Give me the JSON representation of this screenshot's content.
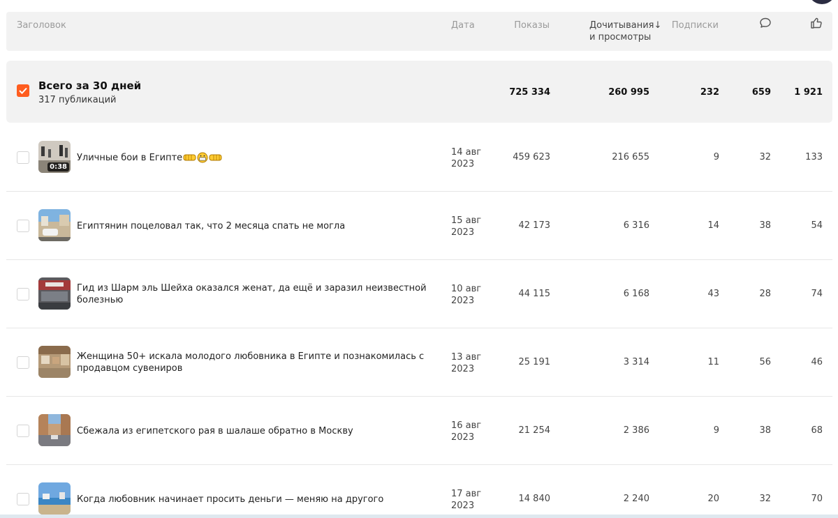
{
  "header": {
    "title": "Заголовок",
    "date": "Дата",
    "views": "Показы",
    "reads_line1": "Дочитывания",
    "reads_arrow": "↓",
    "reads_line2": "и просмотры",
    "subs": "Подписки",
    "comments_icon": "comment-icon",
    "likes_icon": "thumbs-up-icon"
  },
  "total": {
    "title": "Всего за 30 дней",
    "subtitle": "317 публикаций",
    "views": "725 334",
    "reads": "260 995",
    "subs": "232",
    "comments": "659",
    "likes": "1 921",
    "checkbox_color": "#ff5d1f"
  },
  "rows": [
    {
      "title": "Уличные бои в Египте",
      "duration": "0:38",
      "date_day": "14 авг",
      "date_year": "2023",
      "views": "459 623",
      "reads": "216 655",
      "subs": "9",
      "comments": "32",
      "likes": "133"
    },
    {
      "title": "Египтянин поцеловал так, что 2 месяца спать не могла",
      "date_day": "15 авг",
      "date_year": "2023",
      "views": "42 173",
      "reads": "6 316",
      "subs": "14",
      "comments": "38",
      "likes": "54"
    },
    {
      "title": "Гид из Шарм эль Шейха оказался женат, да ещё и заразил неизвестной болезнью",
      "date_day": "10 авг",
      "date_year": "2023",
      "views": "44 115",
      "reads": "6 168",
      "subs": "43",
      "comments": "28",
      "likes": "74"
    },
    {
      "title": "Женщина 50+ искала молодого любовника в Египте и познакомилась с продавцом сувениров",
      "date_day": "13 авг",
      "date_year": "2023",
      "views": "25 191",
      "reads": "3 314",
      "subs": "11",
      "comments": "56",
      "likes": "46"
    },
    {
      "title": "Сбежала из египетского рая в шалаше обратно в Москву",
      "date_day": "16 авг",
      "date_year": "2023",
      "views": "21 254",
      "reads": "2 386",
      "subs": "9",
      "comments": "38",
      "likes": "68"
    },
    {
      "title": "Когда любовник начинает просить деньги — меняю на другого",
      "date_day": "17 авг",
      "date_year": "2023",
      "views": "14 840",
      "reads": "2 240",
      "subs": "20",
      "comments": "32",
      "likes": "70"
    }
  ]
}
